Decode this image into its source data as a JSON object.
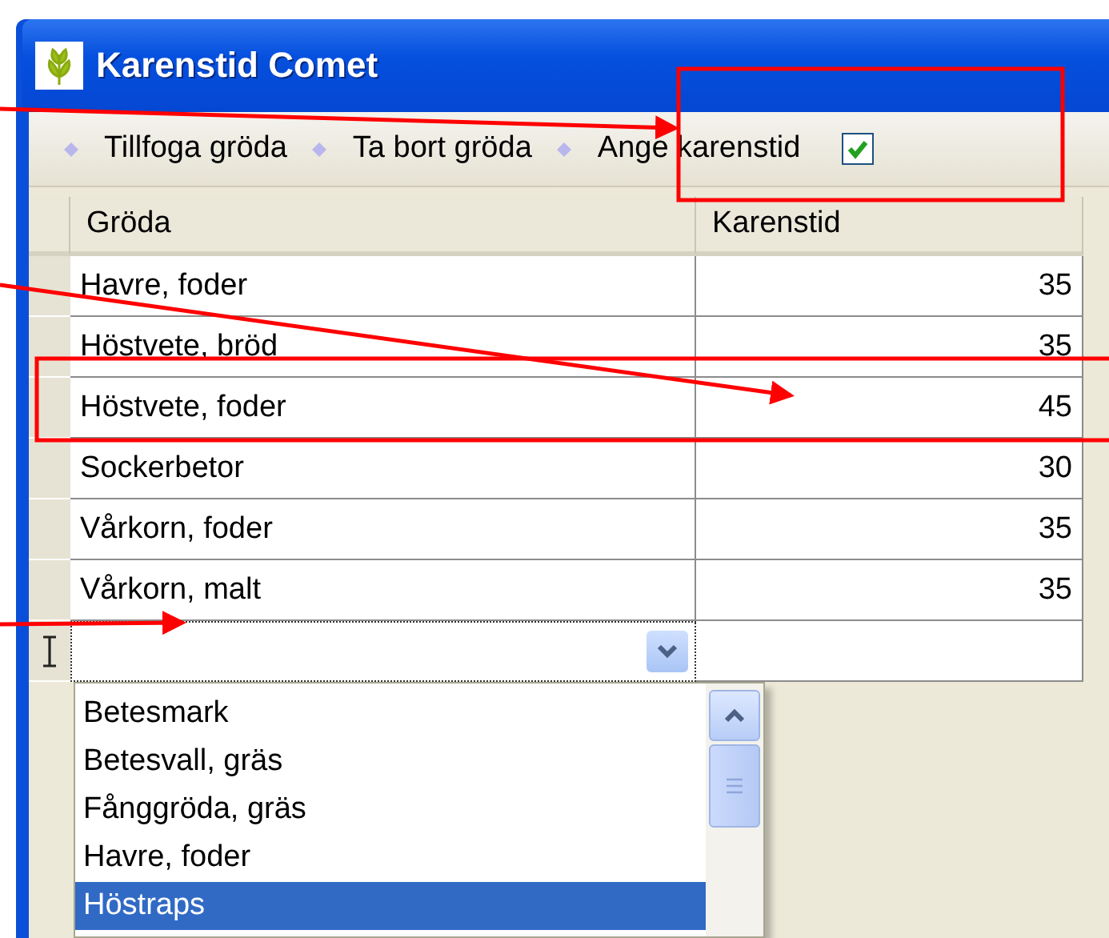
{
  "window": {
    "title": "Karenstid Comet"
  },
  "toolbar": [
    {
      "kind": "button",
      "label": "Tillfoga gröda"
    },
    {
      "kind": "button",
      "label": "Ta bort gröda"
    },
    {
      "kind": "checkbox",
      "label": "Ange karenstid",
      "checked": true
    }
  ],
  "table": {
    "columns": [
      "Gröda",
      "Karenstid"
    ],
    "rows": [
      {
        "groda": "Havre, foder",
        "karenstid": "35"
      },
      {
        "groda": "Höstvete, bröd",
        "karenstid": "35"
      },
      {
        "groda": "Höstvete, foder",
        "karenstid": "45"
      },
      {
        "groda": "Sockerbetor",
        "karenstid": "30"
      },
      {
        "groda": "Vårkorn, foder",
        "karenstid": "35"
      },
      {
        "groda": "Vårkorn, malt",
        "karenstid": "35"
      }
    ]
  },
  "dropdown": {
    "items": [
      {
        "label": "Betesmark",
        "selected": false
      },
      {
        "label": "Betesvall, gräs",
        "selected": false
      },
      {
        "label": "Fånggröda, gräs",
        "selected": false
      },
      {
        "label": "Havre, foder",
        "selected": false
      },
      {
        "label": "Höstraps",
        "selected": true
      }
    ]
  }
}
